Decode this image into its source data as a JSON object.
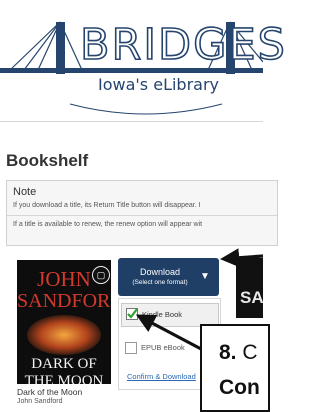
{
  "header": {
    "brand_name": "BRIDGES",
    "brand_subtitle": "Iowa's eLibrary",
    "colors": {
      "brand": "#26456e"
    }
  },
  "page": {
    "title": "Bookshelf"
  },
  "note": {
    "title": "Note",
    "line1": "If you download a title, its Return Title button will disappear. I",
    "line2": "If a title is available to renew, the renew option will appear wit"
  },
  "book": {
    "title": "Dark of the Moon",
    "author": "John Sandford",
    "cover": {
      "author_line1": "JOHN",
      "author_line2": "SANDFORD",
      "title_line1": "DARK OF THE MOON",
      "icon": "book-format-icon"
    }
  },
  "download": {
    "label": "Download",
    "sublabel": "(Select one format)",
    "caret_icon": "chevron-down-icon",
    "colors": {
      "button": "#1f3f66"
    },
    "formats": [
      {
        "label": "Kindle Book",
        "checked": true
      },
      {
        "label": "EPUB eBook",
        "checked": false
      }
    ],
    "confirm_label": "Confirm & Download"
  },
  "neighbor": {
    "cover_text": "SA"
  },
  "callout": {
    "step_number": "8.",
    "line1_text": "C",
    "line2_text": "Con"
  }
}
